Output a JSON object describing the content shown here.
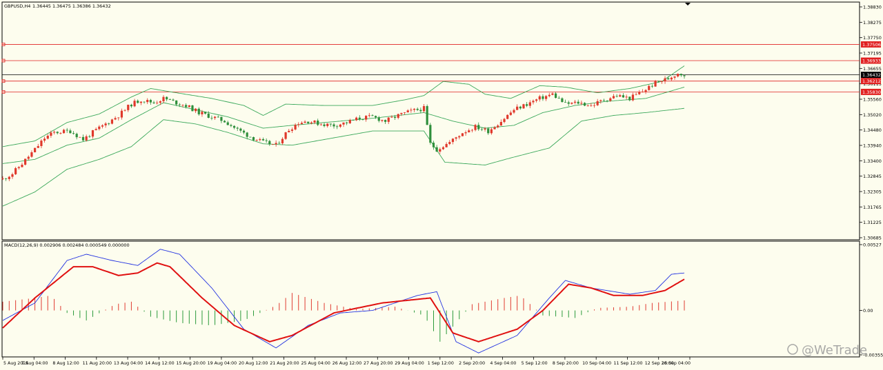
{
  "header": {
    "symbol": "GBPUSD,H4",
    "ohlc": "1.36445 1.36475 1.36386 1.36432"
  },
  "macd_header": "MACD(12,26,9) 0.002906 0.002484 0.000549 0.000000",
  "watermark": {
    "text": "@WeTrade"
  },
  "colors": {
    "background": "#fdfdee",
    "bull": "#e0382b",
    "bear": "#2f8f3c",
    "bollinger": "#3aa85a",
    "hline": "#e02020",
    "current_price_line": "#000000",
    "macd_line": "#e01010",
    "signal_line": "#2030e0",
    "hist_pos": "#e03a30",
    "hist_neg": "#2a9a3a"
  },
  "price_axis": {
    "ticks": [
      "1.38830",
      "1.38275",
      "1.37750",
      "1.37195",
      "1.36655",
      "1.36115",
      "1.35560",
      "1.35020",
      "1.34480",
      "1.33940",
      "1.33400",
      "1.32845",
      "1.32305",
      "1.31765",
      "1.31225",
      "1.30685"
    ],
    "labels": [
      {
        "text": "1.37506",
        "type": "level"
      },
      {
        "text": "1.36933",
        "type": "level"
      },
      {
        "text": "1.36432",
        "type": "current"
      },
      {
        "text": "1.36212",
        "type": "level"
      },
      {
        "text": "1.35830",
        "type": "level"
      }
    ]
  },
  "macd_axis": {
    "ticks": [
      "0.00527",
      "0.00",
      "-0.003553"
    ]
  },
  "time_axis": {
    "labels": [
      "5 Aug 2025",
      "7 Aug 04:00",
      "8 Aug 12:00",
      "11 Aug 20:00",
      "13 Aug 04:00",
      "14 Aug 12:00",
      "15 Aug 20:00",
      "19 Aug 04:00",
      "20 Aug 12:00",
      "21 Aug 20:00",
      "25 Aug 04:00",
      "26 Aug 12:00",
      "27 Aug 20:00",
      "29 Aug 04:00",
      "1 Sep 12:00",
      "2 Sep 20:00",
      "4 Sep 04:00",
      "5 Sep 12:00",
      "8 Sep 20:00",
      "10 Sep 04:00",
      "11 Sep 12:00",
      "12 Sep 20:00",
      "16 Sep 04:00"
    ]
  },
  "chart_data": {
    "type": "candlestick",
    "symbol": "GBPUSD",
    "timeframe": "H4",
    "price_range": [
      1.30685,
      1.3883
    ],
    "horizontal_lines": [
      1.37506,
      1.36933,
      1.36212,
      1.3583
    ],
    "current_price": 1.36432,
    "close_path": [
      [
        0,
        1.3275
      ],
      [
        6,
        1.3295
      ],
      [
        12,
        1.333
      ],
      [
        20,
        1.338
      ],
      [
        26,
        1.342
      ],
      [
        32,
        1.344
      ],
      [
        42,
        1.3445
      ],
      [
        50,
        1.3415
      ],
      [
        56,
        1.344
      ],
      [
        64,
        1.347
      ],
      [
        72,
        1.35
      ],
      [
        80,
        1.354
      ],
      [
        86,
        1.3555
      ],
      [
        94,
        1.3545
      ],
      [
        100,
        1.356
      ],
      [
        108,
        1.3545
      ],
      [
        114,
        1.3535
      ],
      [
        122,
        1.351
      ],
      [
        130,
        1.3495
      ],
      [
        138,
        1.348
      ],
      [
        146,
        1.345
      ],
      [
        154,
        1.3425
      ],
      [
        162,
        1.3405
      ],
      [
        170,
        1.3395
      ],
      [
        178,
        1.345
      ],
      [
        184,
        1.3475
      ],
      [
        190,
        1.348
      ],
      [
        198,
        1.347
      ],
      [
        206,
        1.3465
      ],
      [
        214,
        1.3475
      ],
      [
        222,
        1.349
      ],
      [
        230,
        1.3495
      ],
      [
        238,
        1.348
      ],
      [
        246,
        1.35
      ],
      [
        254,
        1.3515
      ],
      [
        262,
        1.3525
      ],
      [
        266,
        1.34
      ],
      [
        270,
        1.338
      ],
      [
        278,
        1.3405
      ],
      [
        286,
        1.344
      ],
      [
        294,
        1.346
      ],
      [
        302,
        1.3445
      ],
      [
        310,
        1.348
      ],
      [
        318,
        1.352
      ],
      [
        326,
        1.354
      ],
      [
        334,
        1.356
      ],
      [
        342,
        1.3575
      ],
      [
        350,
        1.354
      ],
      [
        358,
        1.3545
      ],
      [
        366,
        1.3535
      ],
      [
        374,
        1.3555
      ],
      [
        382,
        1.357
      ],
      [
        390,
        1.356
      ],
      [
        398,
        1.3585
      ],
      [
        406,
        1.3615
      ],
      [
        414,
        1.363
      ],
      [
        420,
        1.365
      ],
      [
        424,
        1.3643
      ]
    ],
    "bollinger": {
      "upper": [
        [
          0,
          1.339
        ],
        [
          20,
          1.341
        ],
        [
          40,
          1.3475
        ],
        [
          60,
          1.3505
        ],
        [
          80,
          1.3565
        ],
        [
          92,
          1.3595
        ],
        [
          108,
          1.358
        ],
        [
          130,
          1.356
        ],
        [
          150,
          1.3535
        ],
        [
          162,
          1.35
        ],
        [
          176,
          1.354
        ],
        [
          200,
          1.3535
        ],
        [
          230,
          1.3535
        ],
        [
          250,
          1.3555
        ],
        [
          262,
          1.357
        ],
        [
          274,
          1.362
        ],
        [
          290,
          1.361
        ],
        [
          300,
          1.3575
        ],
        [
          316,
          1.356
        ],
        [
          334,
          1.3605
        ],
        [
          350,
          1.36
        ],
        [
          370,
          1.358
        ],
        [
          390,
          1.3595
        ],
        [
          410,
          1.362
        ],
        [
          424,
          1.3675
        ]
      ],
      "middle": [
        [
          0,
          1.333
        ],
        [
          20,
          1.3345
        ],
        [
          40,
          1.3395
        ],
        [
          60,
          1.342
        ],
        [
          80,
          1.3485
        ],
        [
          100,
          1.3545
        ],
        [
          120,
          1.352
        ],
        [
          140,
          1.3495
        ],
        [
          162,
          1.3455
        ],
        [
          180,
          1.3465
        ],
        [
          200,
          1.3475
        ],
        [
          230,
          1.349
        ],
        [
          262,
          1.351
        ],
        [
          280,
          1.348
        ],
        [
          300,
          1.3455
        ],
        [
          318,
          1.3465
        ],
        [
          336,
          1.351
        ],
        [
          356,
          1.3535
        ],
        [
          376,
          1.355
        ],
        [
          400,
          1.356
        ],
        [
          424,
          1.36
        ]
      ],
      "lower": [
        [
          0,
          1.318
        ],
        [
          20,
          1.323
        ],
        [
          40,
          1.331
        ],
        [
          60,
          1.3345
        ],
        [
          80,
          1.339
        ],
        [
          100,
          1.3485
        ],
        [
          120,
          1.347
        ],
        [
          140,
          1.344
        ],
        [
          162,
          1.34
        ],
        [
          180,
          1.3395
        ],
        [
          200,
          1.3415
        ],
        [
          230,
          1.3445
        ],
        [
          262,
          1.3445
        ],
        [
          275,
          1.3335
        ],
        [
          300,
          1.3325
        ],
        [
          316,
          1.335
        ],
        [
          340,
          1.3385
        ],
        [
          360,
          1.348
        ],
        [
          380,
          1.35
        ],
        [
          400,
          1.351
        ],
        [
          424,
          1.3525
        ]
      ]
    },
    "macd": {
      "params": "12,26,9",
      "range": [
        -0.003553,
        0.00527
      ],
      "macd": [
        [
          0,
          -0.0014
        ],
        [
          20,
          0.001
        ],
        [
          44,
          0.0035
        ],
        [
          56,
          0.0035
        ],
        [
          72,
          0.0028
        ],
        [
          84,
          0.003
        ],
        [
          96,
          0.0038
        ],
        [
          104,
          0.0035
        ],
        [
          124,
          0.001
        ],
        [
          144,
          -0.0012
        ],
        [
          166,
          -0.0025
        ],
        [
          180,
          -0.002
        ],
        [
          206,
          -0.0002
        ],
        [
          236,
          0.0006
        ],
        [
          266,
          0.001
        ],
        [
          280,
          -0.0018
        ],
        [
          296,
          -0.0025
        ],
        [
          320,
          -0.0015
        ],
        [
          336,
          0.0
        ],
        [
          352,
          0.0021
        ],
        [
          366,
          0.0018
        ],
        [
          380,
          0.0012
        ],
        [
          398,
          0.0012
        ],
        [
          412,
          0.0016
        ],
        [
          424,
          0.0025
        ]
      ],
      "signal": [
        [
          0,
          -0.0008
        ],
        [
          20,
          0.0006
        ],
        [
          40,
          0.004
        ],
        [
          52,
          0.0045
        ],
        [
          68,
          0.004
        ],
        [
          84,
          0.0036
        ],
        [
          98,
          0.0049
        ],
        [
          110,
          0.0045
        ],
        [
          130,
          0.0018
        ],
        [
          150,
          -0.0015
        ],
        [
          170,
          -0.003
        ],
        [
          190,
          -0.0012
        ],
        [
          210,
          -0.0002
        ],
        [
          230,
          0.0
        ],
        [
          258,
          0.0012
        ],
        [
          270,
          0.0015
        ],
        [
          282,
          -0.0025
        ],
        [
          296,
          -0.0034
        ],
        [
          320,
          -0.002
        ],
        [
          340,
          0.001
        ],
        [
          350,
          0.0024
        ],
        [
          366,
          0.0018
        ],
        [
          390,
          0.0013
        ],
        [
          406,
          0.0016
        ],
        [
          416,
          0.0029
        ],
        [
          424,
          0.003
        ]
      ],
      "histogram": [
        [
          0,
          0.0007
        ],
        [
          20,
          0.001
        ],
        [
          30,
          0.0012
        ],
        [
          40,
          -0.0002
        ],
        [
          52,
          -0.0008
        ],
        [
          70,
          0.0005
        ],
        [
          80,
          0.0007
        ],
        [
          92,
          -0.0005
        ],
        [
          110,
          -0.001
        ],
        [
          130,
          -0.0012
        ],
        [
          150,
          -0.0008
        ],
        [
          170,
          0.0004
        ],
        [
          180,
          0.0014
        ],
        [
          200,
          0.0006
        ],
        [
          220,
          0.0001
        ],
        [
          244,
          0.0003
        ],
        [
          262,
          -0.0004
        ],
        [
          272,
          -0.0025
        ],
        [
          282,
          -0.001
        ],
        [
          292,
          0.0005
        ],
        [
          312,
          0.001
        ],
        [
          322,
          0.0012
        ],
        [
          336,
          -0.0004
        ],
        [
          356,
          -0.0006
        ],
        [
          370,
          0.0002
        ],
        [
          390,
          0.0003
        ],
        [
          404,
          0.0006
        ],
        [
          424,
          0.0008
        ]
      ]
    }
  }
}
